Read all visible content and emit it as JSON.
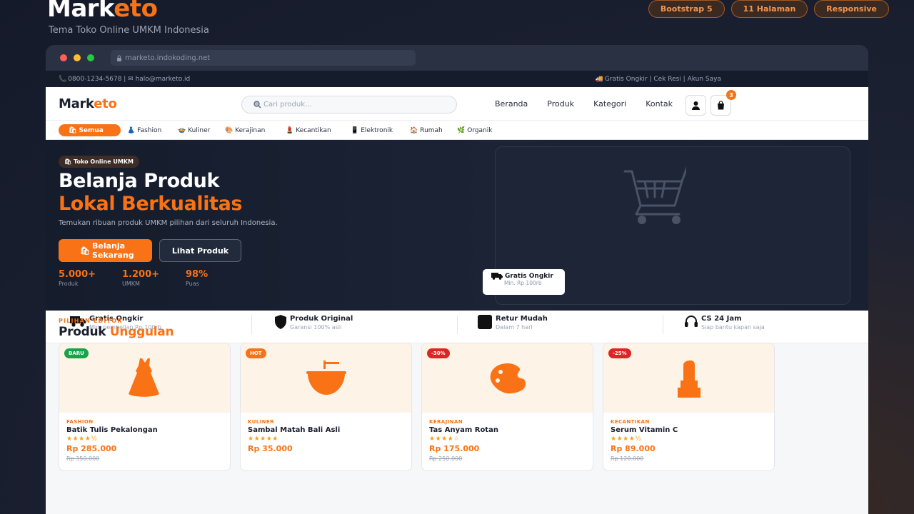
{
  "showcase": {
    "brand_white": "Mark",
    "brand_orange": "eto",
    "subtitle": "Tema Toko Online UMKM Indonesia",
    "pills": [
      "Bootstrap 5",
      "11 Halaman",
      "Responsive"
    ]
  },
  "browser": {
    "url": "marketo.indokoding.net",
    "dots": [
      "#ff5f57",
      "#febc2e",
      "#28c840"
    ]
  },
  "topbar": {
    "contact": "0800-1234-5678 | ✉ halo@marketo.id",
    "links": "Gratis Ongkir | Cek Resi | Akun Saya"
  },
  "navbar": {
    "logo_a": "Mark",
    "logo_b": "eto",
    "search_placeholder": "Cari produk...",
    "menu": [
      "Beranda",
      "Produk",
      "Kategori",
      "Kontak"
    ],
    "cart_count": "3"
  },
  "categories": [
    "Semua",
    "Fashion",
    "Kuliner",
    "Kerajinan",
    "Kecantikan",
    "Elektronik",
    "Rumah",
    "Organik"
  ],
  "hero": {
    "tag": "Toko Online UMKM",
    "line1": "Belanja Produk",
    "line2": "Lokal Berkualitas",
    "desc": "Temukan ribuan produk UMKM pilihan dari seluruh Indonesia.",
    "cta_primary": "Belanja Sekarang",
    "cta_secondary": "Lihat Produk",
    "stats": [
      {
        "num": "5.000+",
        "label": "Produk"
      },
      {
        "num": "1.200+",
        "label": "UMKM"
      },
      {
        "num": "98%",
        "label": "Puas"
      }
    ],
    "float_title": "Gratis Ongkir",
    "float_sub": "Min. Rp 100rb"
  },
  "features": [
    {
      "title": "Gratis Ongkir",
      "sub": "Min. pembelian Rp 100rb"
    },
    {
      "title": "Produk Original",
      "sub": "Garansi 100% asli"
    },
    {
      "title": "Retur Mudah",
      "sub": "Dalam 7 hari"
    },
    {
      "title": "CS 24 Jam",
      "sub": "Siap bantu kapan saja"
    }
  ],
  "section": {
    "eyebrow": "PILIHAN EDITOR",
    "title_a": "Produk ",
    "title_b": "Unggulan"
  },
  "products": [
    {
      "tag": "BARU",
      "tag_color": "#16a34a",
      "category": "FASHION",
      "name": "Batik Tulis Pekalongan",
      "stars": "★★★★½",
      "price": "Rp 285.000",
      "old": "Rp 350.000"
    },
    {
      "tag": "HOT",
      "tag_color": "#f97316",
      "category": "KULINER",
      "name": "Sambal Matah Bali Asli",
      "stars": "★★★★★",
      "price": "Rp 35.000",
      "old": ""
    },
    {
      "tag": "-30%",
      "tag_color": "#dc2626",
      "category": "KERAJINAN",
      "name": "Tas Anyam Rotan",
      "stars": "★★★★☆",
      "price": "Rp 175.000",
      "old": "Rp 250.000"
    },
    {
      "tag": "-25%",
      "tag_color": "#dc2626",
      "category": "KECANTIKAN",
      "name": "Serum Vitamin C",
      "stars": "★★★★½",
      "price": "Rp 89.000",
      "old": "Rp 120.000"
    }
  ],
  "colors": {
    "accent": "#f97316",
    "dark": "#151c2c"
  }
}
